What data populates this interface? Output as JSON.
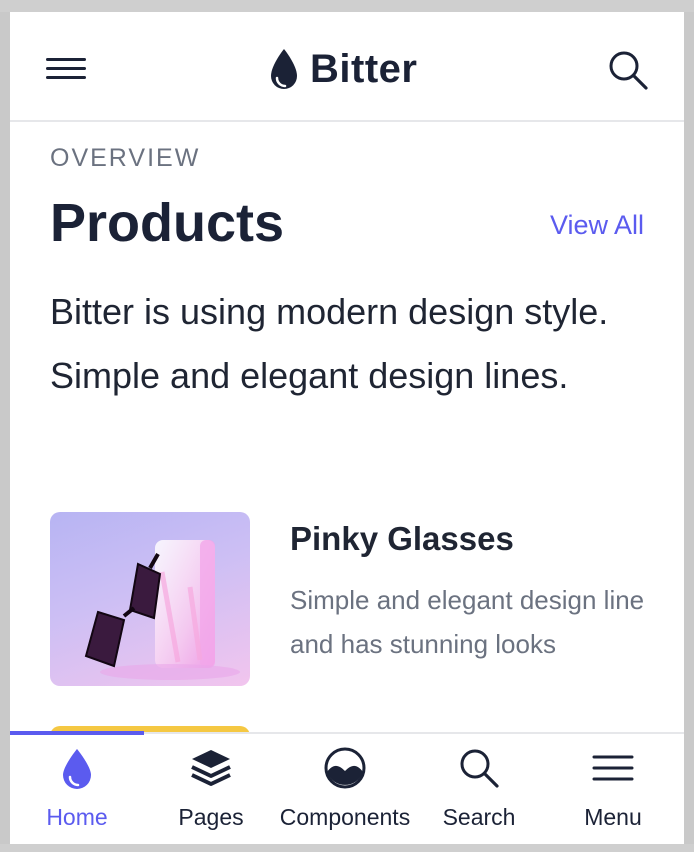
{
  "header": {
    "brand": "Bitter"
  },
  "section": {
    "overline": "OVERVIEW",
    "title": "Products",
    "view_all": "View All",
    "intro": "Bitter is using modern design style. Simple and elegant design lines."
  },
  "products": [
    {
      "name": "Pinky Glasses",
      "description": "Simple and elegant design line and has stunning looks"
    }
  ],
  "bottom_nav": {
    "items": [
      {
        "label": "Home",
        "icon": "drop-icon",
        "active": true
      },
      {
        "label": "Pages",
        "icon": "layers-icon",
        "active": false
      },
      {
        "label": "Components",
        "icon": "components-icon",
        "active": false
      },
      {
        "label": "Search",
        "icon": "search-icon",
        "active": false
      },
      {
        "label": "Menu",
        "icon": "menu-icon",
        "active": false
      }
    ]
  },
  "colors": {
    "accent": "#5b5bef",
    "text_dark": "#1b2236",
    "text_muted": "#6b7280"
  }
}
